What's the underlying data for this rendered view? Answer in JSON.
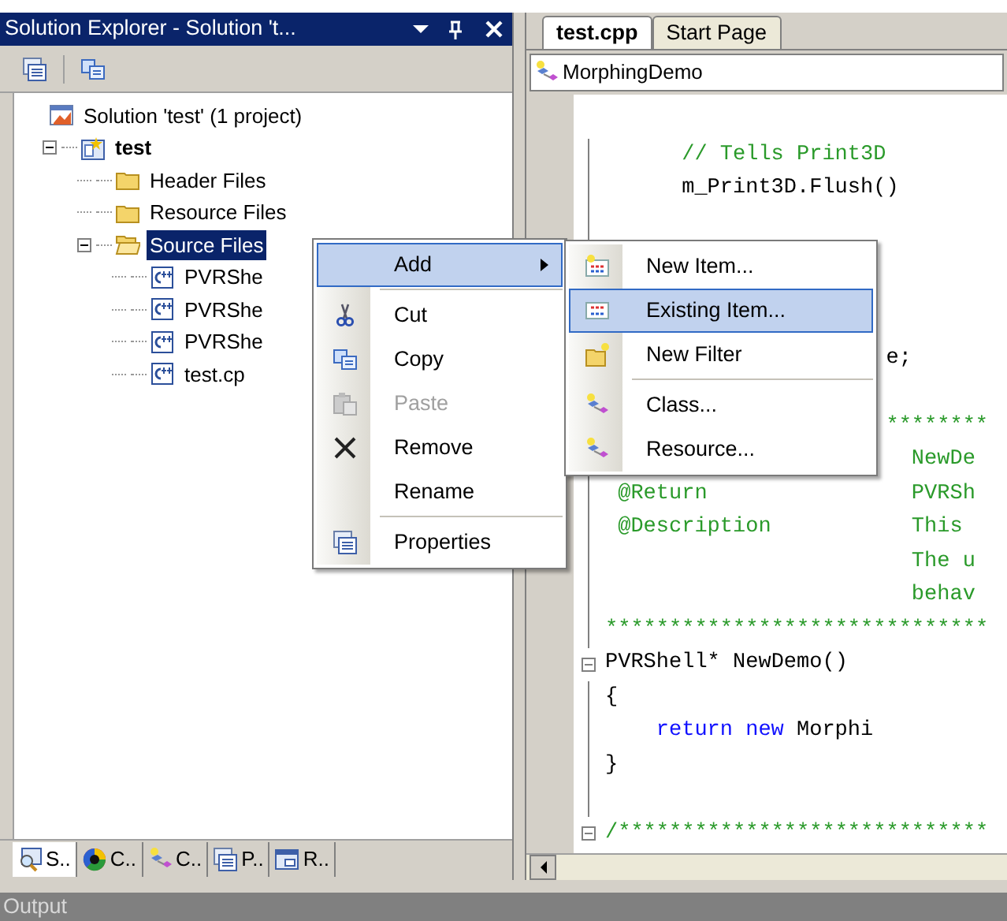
{
  "solution_explorer": {
    "title": "Solution Explorer - Solution 't...",
    "tree": [
      {
        "label": "Solution 'test' (1 project)",
        "selected": false,
        "children": [
          {
            "label": "test",
            "selected": false,
            "expanded": true,
            "children": [
              {
                "label": "Header Files",
                "selected": false
              },
              {
                "label": "Resource Files",
                "selected": false
              },
              {
                "label": "Source Files",
                "selected": true,
                "expanded": true,
                "children": [
                  {
                    "label": "PVRShe",
                    "selected": false
                  },
                  {
                    "label": "PVRShe",
                    "selected": false
                  },
                  {
                    "label": "PVRShe",
                    "selected": false
                  },
                  {
                    "label": "test.cp",
                    "selected": false
                  }
                ]
              }
            ]
          }
        ]
      }
    ],
    "bottom_tabs": [
      {
        "label": "S..",
        "selected": true
      },
      {
        "label": "C..",
        "selected": false
      },
      {
        "label": "C..",
        "selected": false
      },
      {
        "label": "P..",
        "selected": false
      },
      {
        "label": "R..",
        "selected": false
      }
    ]
  },
  "editor": {
    "tabs": [
      {
        "label": "test.cpp",
        "selected": true
      },
      {
        "label": "Start Page",
        "selected": false
      }
    ],
    "dropdown": {
      "value": "MorphingDemo"
    },
    "lines": [
      {
        "kind": "code",
        "segments": [
          {
            "kind": "comment",
            "text": "// Tells Print3D"
          }
        ]
      },
      {
        "kind": "code",
        "segments": [
          {
            "kind": "plain",
            "text": "m_Print3D.Flush()"
          }
        ]
      },
      {
        "kind": "blank"
      },
      {
        "kind": "blank"
      },
      {
        "kind": "blank"
      },
      {
        "kind": "blank"
      },
      {
        "kind": "code",
        "segments": [
          {
            "kind": "plain",
            "text": "e;"
          }
        ]
      },
      {
        "kind": "blank"
      },
      {
        "kind": "code",
        "segments": [
          {
            "kind": "comment",
            "text": "********"
          }
        ]
      },
      {
        "kind": "code",
        "segments": [
          {
            "kind": "comment",
            "text": "NewDe"
          }
        ]
      },
      {
        "kind": "code",
        "segments": [
          {
            "kind": "comment",
            "text": "@Return"
          },
          {
            "kind": "comment",
            "text": "PVRSh"
          }
        ]
      },
      {
        "kind": "code",
        "segments": [
          {
            "kind": "comment",
            "text": "@Description"
          },
          {
            "kind": "comment",
            "text": "This"
          }
        ]
      },
      {
        "kind": "code",
        "segments": [
          {
            "kind": "comment",
            "text": "The u"
          }
        ]
      },
      {
        "kind": "code",
        "segments": [
          {
            "kind": "comment",
            "text": "behav"
          }
        ]
      },
      {
        "kind": "code",
        "segments": [
          {
            "kind": "comment",
            "text": "******************************"
          }
        ]
      },
      {
        "kind": "fold",
        "segments": [
          {
            "kind": "plain",
            "text": "PVRShell* NewDemo()"
          }
        ]
      },
      {
        "kind": "code",
        "segments": [
          {
            "kind": "plain",
            "text": "{"
          }
        ]
      },
      {
        "kind": "code",
        "segments": [
          {
            "kind": "keyword",
            "text": "return new"
          },
          {
            "kind": "plain",
            "text": "Morphi"
          }
        ]
      },
      {
        "kind": "code",
        "segments": [
          {
            "kind": "plain",
            "text": "}"
          }
        ]
      },
      {
        "kind": "blank"
      },
      {
        "kind": "fold",
        "segments": [
          {
            "kind": "comment",
            "text": "/*****************************"
          }
        ]
      }
    ]
  },
  "context_menu": {
    "items": [
      {
        "kind": "item",
        "label": "Add",
        "selected": true,
        "disabled": false,
        "submenu": true
      },
      {
        "kind": "separator"
      },
      {
        "kind": "item",
        "label": "Cut",
        "selected": false,
        "disabled": false,
        "submenu": false
      },
      {
        "kind": "item",
        "label": "Copy",
        "selected": false,
        "disabled": false,
        "submenu": false
      },
      {
        "kind": "item",
        "label": "Paste",
        "selected": false,
        "disabled": true,
        "submenu": false
      },
      {
        "kind": "item",
        "label": "Remove",
        "selected": false,
        "disabled": false,
        "submenu": false
      },
      {
        "kind": "item",
        "label": "Rename",
        "selected": false,
        "disabled": false,
        "submenu": false
      },
      {
        "kind": "separator"
      },
      {
        "kind": "item",
        "label": "Properties",
        "selected": false,
        "disabled": false,
        "submenu": false
      }
    ]
  },
  "submenu": {
    "items": [
      {
        "kind": "item",
        "label": "New Item...",
        "selected": false,
        "disabled": false,
        "submenu": false
      },
      {
        "kind": "item",
        "label": "Existing Item...",
        "selected": true,
        "disabled": false,
        "submenu": false
      },
      {
        "kind": "item",
        "label": "New Filter",
        "selected": false,
        "disabled": false,
        "submenu": false
      },
      {
        "kind": "separator"
      },
      {
        "kind": "item",
        "label": "Class...",
        "selected": false,
        "disabled": false,
        "submenu": false
      },
      {
        "kind": "item",
        "label": "Resource...",
        "selected": false,
        "disabled": false,
        "submenu": false
      }
    ]
  },
  "output_bar": {
    "title": "Output"
  }
}
